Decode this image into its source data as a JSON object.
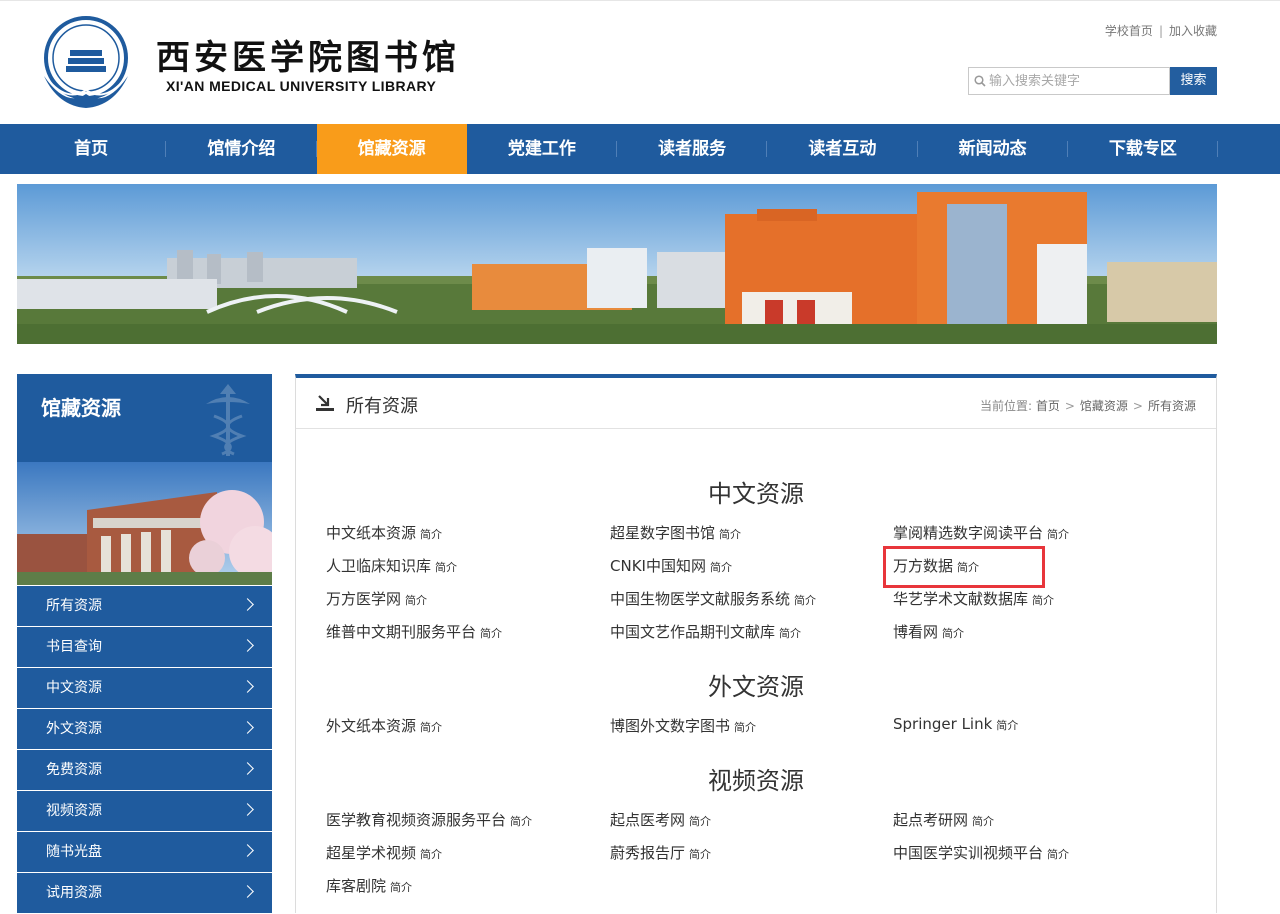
{
  "header": {
    "logo_cn": "西安医学院图书馆",
    "logo_en": "XI'AN MEDICAL UNIVERSITY LIBRARY",
    "links": [
      "学校首页",
      "加入收藏"
    ],
    "link_sep": "|",
    "search_placeholder": "输入搜索关键字",
    "search_button": "搜索"
  },
  "nav": [
    "首页",
    "馆情介绍",
    "馆藏资源",
    "党建工作",
    "读者服务",
    "读者互动",
    "新闻动态",
    "下载专区"
  ],
  "nav_active_index": 2,
  "sidebar": {
    "title": "馆藏资源",
    "items": [
      "所有资源",
      "书目查询",
      "中文资源",
      "外文资源",
      "免费资源",
      "视频资源",
      "随书光盘",
      "试用资源"
    ]
  },
  "panel": {
    "title": "所有资源",
    "crumb_label": "当前位置:",
    "crumb": [
      "首页",
      "馆藏资源",
      "所有资源"
    ],
    "crumb_sep": ">"
  },
  "brief_label": "简介",
  "sections": [
    {
      "title": "中文资源",
      "items": [
        "中文纸本资源",
        "超星数字图书馆",
        "掌阅精选数字阅读平台",
        "人卫临床知识库",
        "CNKI中国知网",
        "万方数据",
        "万方医学网",
        "中国生物医学文献服务系统",
        "华艺学术文献数据库",
        "维普中文期刊服务平台",
        "中国文艺作品期刊文献库",
        "博看网"
      ]
    },
    {
      "title": "外文资源",
      "items": [
        "外文纸本资源",
        "博图外文数字图书",
        "Springer Link"
      ]
    },
    {
      "title": "视频资源",
      "items": [
        "医学教育视频资源服务平台",
        "起点医考网",
        "起点考研网",
        "超星学术视频",
        "蔚秀报告厅",
        "中国医学实训视频平台",
        "库客剧院"
      ]
    }
  ],
  "colors": {
    "primary_blue": "#1f5b9e",
    "active_orange": "#f99c1a",
    "highlight_red": "#e8353b"
  }
}
